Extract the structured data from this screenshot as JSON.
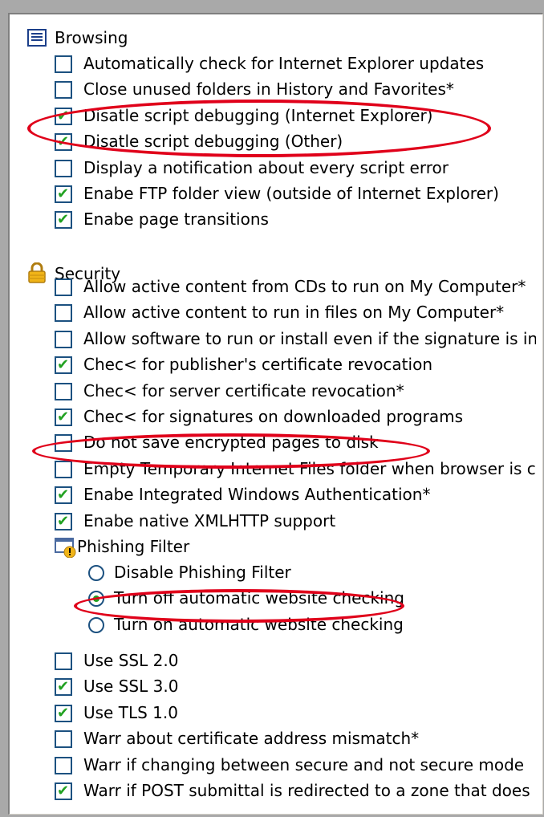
{
  "browsing": {
    "title": "Browsing",
    "icon": "settings-list-icon",
    "items": [
      {
        "label": "Automatically check for Internet Explorer updates",
        "checked": false
      },
      {
        "label": "Close unused folders in History and Favorites*",
        "checked": false
      },
      {
        "label": "Disatle script debugging (Internet Explorer)",
        "checked": true
      },
      {
        "label": "Disatle script debugging (Other)",
        "checked": true
      },
      {
        "label": "Display a notification about every script error",
        "checked": false
      },
      {
        "label": "Enabe FTP folder view (outside of Internet Explorer)",
        "checked": true
      },
      {
        "label": "Enabe page transitions",
        "checked": true
      }
    ]
  },
  "security": {
    "title": "Security",
    "icon": "lock-icon",
    "items": [
      {
        "label": "Allow active content from CDs to run on My Computer*",
        "checked": false
      },
      {
        "label": "Allow active content to run in files on My Computer*",
        "checked": false
      },
      {
        "label": "Allow software to run or install even if the signature is inv.",
        "checked": false
      },
      {
        "label": "Chec< for publisher's certificate revocation",
        "checked": true
      },
      {
        "label": "Chec< for server certificate revocation*",
        "checked": false
      },
      {
        "label": "Chec< for signatures on downloaded programs",
        "checked": true
      },
      {
        "label": "Do not save encrypted pages to disk",
        "checked": false
      },
      {
        "label": "Empty Temporary Internet Files folder when browser is clc",
        "checked": false
      },
      {
        "label": "Enabe Integrated Windows Authentication*",
        "checked": true
      },
      {
        "label": "Enabe native XMLHTTP support",
        "checked": true
      }
    ],
    "phishing": {
      "title": "Phishing Filter",
      "icon": "phishing-warning-icon",
      "options": [
        {
          "label": "Disable Phishing Filter",
          "selected": false
        },
        {
          "label": "Turn off automatic website checking",
          "selected": true
        },
        {
          "label": "Turn on automatic website checking",
          "selected": false
        }
      ]
    },
    "items_after": [
      {
        "label": "Use SSL 2.0",
        "checked": false
      },
      {
        "label": "Use SSL 3.0",
        "checked": true
      },
      {
        "label": "Use TLS 1.0",
        "checked": true
      },
      {
        "label": "Warr about certificate address mismatch*",
        "checked": false
      },
      {
        "label": "Warr if changing between secure and not secure mode",
        "checked": false
      },
      {
        "label": "Warr if POST submittal is redirected to a zone that does n",
        "checked": true
      }
    ]
  },
  "colors": {
    "highlight_oval": "#e0001a",
    "check": "#21a121",
    "box_border": "#1c5180"
  }
}
